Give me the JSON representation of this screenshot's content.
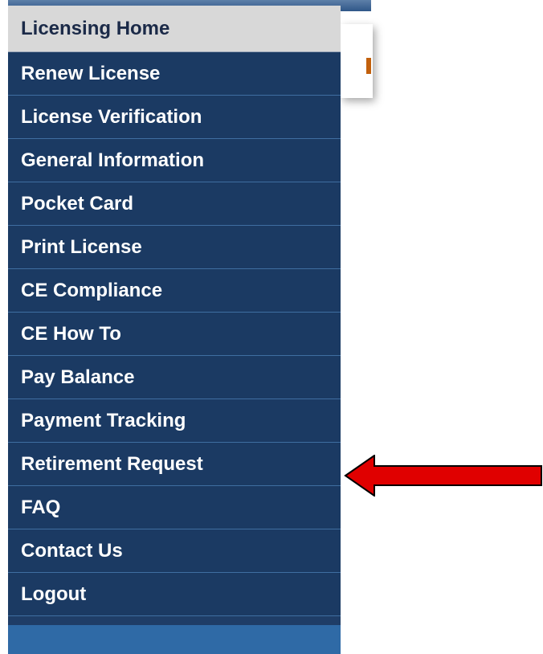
{
  "sidebar": {
    "items": [
      {
        "label": "Licensing Home"
      },
      {
        "label": "Renew License"
      },
      {
        "label": "License Verification"
      },
      {
        "label": "General Information"
      },
      {
        "label": "Pocket Card"
      },
      {
        "label": "Print License"
      },
      {
        "label": "CE Compliance"
      },
      {
        "label": "CE How To"
      },
      {
        "label": "Pay Balance"
      },
      {
        "label": "Payment Tracking"
      },
      {
        "label": "Retirement Request"
      },
      {
        "label": "FAQ"
      },
      {
        "label": "Contact Us"
      },
      {
        "label": "Logout"
      }
    ],
    "active_item": "Licensing Home"
  },
  "annotation": {
    "arrow_target": "Retirement Request",
    "arrow_color": "#e00000"
  },
  "colors": {
    "menu_bg": "#1b3a63",
    "menu_active_bg": "#d8d8d8",
    "menu_text": "#ffffff",
    "menu_divider": "#3f6ea1"
  }
}
